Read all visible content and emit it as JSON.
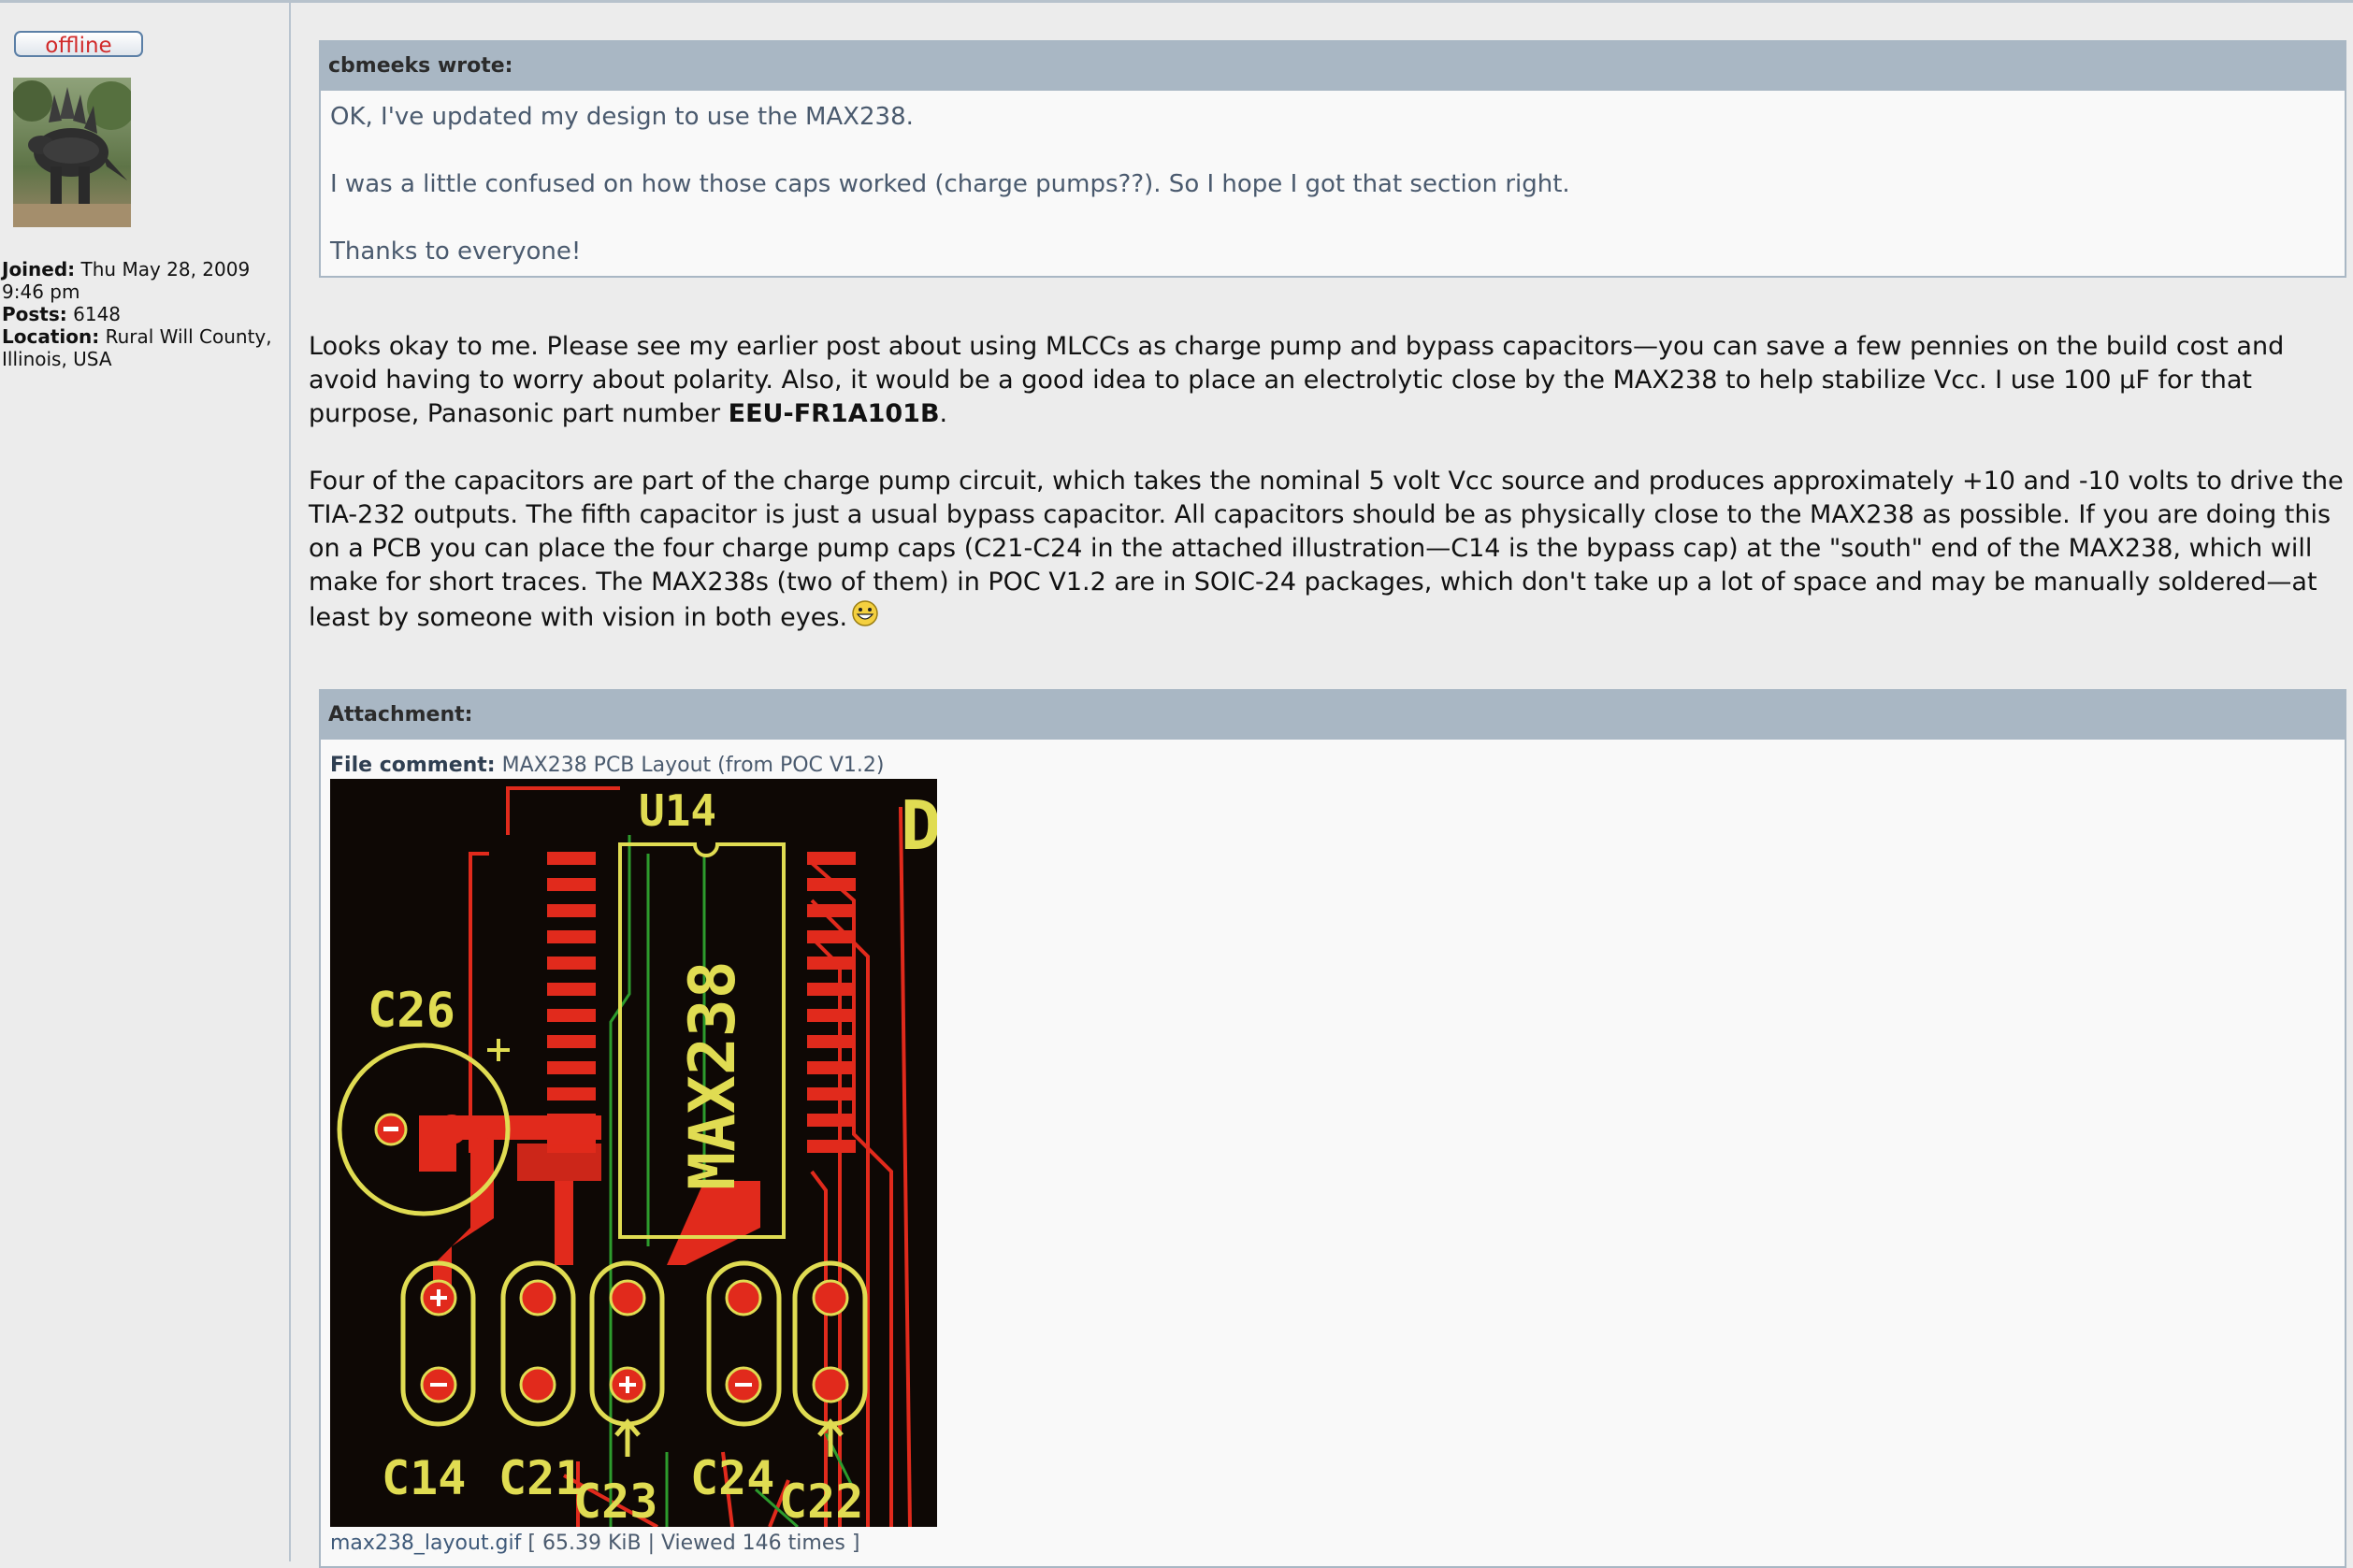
{
  "profile": {
    "status": "offline",
    "joined_label": "Joined:",
    "joined_value": "Thu May 28, 2009 9:46 pm",
    "posts_label": "Posts:",
    "posts_value": "6148",
    "location_label": "Location:",
    "location_value": "Rural Will County, Illinois, USA"
  },
  "quote": {
    "header": "cbmeeks wrote:",
    "lines": [
      "OK, I've updated my design to use the MAX238.",
      "I was a little confused on how those caps worked (charge pumps??). So I hope I got that section right.",
      "Thanks to everyone!"
    ]
  },
  "post": {
    "p1_before": "Looks okay to me. Please see my earlier post about using MLCCs as charge pump and bypass capacitors—you can save a few pennies on the build cost and avoid having to worry about polarity. Also, it would be a good idea to place an electrolytic close by the MAX238 to help stabilize Vcc. I use 100 µF for that purpose, Panasonic part number ",
    "p1_part": "EEU-FR1A101B",
    "p1_after": ".",
    "p2": "Four of the capacitors are part of the charge pump circuit, which takes the nominal 5 volt Vcc source and produces approximately +10 and -10 volts to drive the TIA-232 outputs. The fifth capacitor is just a usual bypass capacitor. All capacitors should be as physically close to the MAX238 as possible. If you are doing this on a PCB you can place the four charge pump caps (C21-C24 in the attached illustration—C14 is the bypass cap) at the \"south\" end of the MAX238, which will make for short traces. The MAX238s (two of them) in POC V1.2 are in SOIC-24 packages, which don't take up a lot of space and may be manually soldered—at least by someone with vision in both eyes."
  },
  "attachment": {
    "header": "Attachment:",
    "comment_label": "File comment:",
    "comment_value": "MAX238 PCB Layout (from POC V1.2)",
    "file_name": "max238_layout.gif",
    "file_meta": "[ 65.39 KiB | Viewed 146 times ]",
    "pcb_labels": {
      "u14": "U14",
      "chip": "MAX238",
      "c26": "C26",
      "c14": "C14",
      "c21": "C21",
      "c24": "C24",
      "c23": "C23",
      "c22": "C22",
      "corner": "D"
    }
  },
  "colors": {
    "header_bg": "#a9b7c4",
    "quote_text": "#4a5a6e",
    "offline_red": "#d12a2a",
    "pcb_bg": "#0e0805",
    "pcb_copper": "#e12a1c",
    "pcb_silk": "#e0dc52"
  }
}
